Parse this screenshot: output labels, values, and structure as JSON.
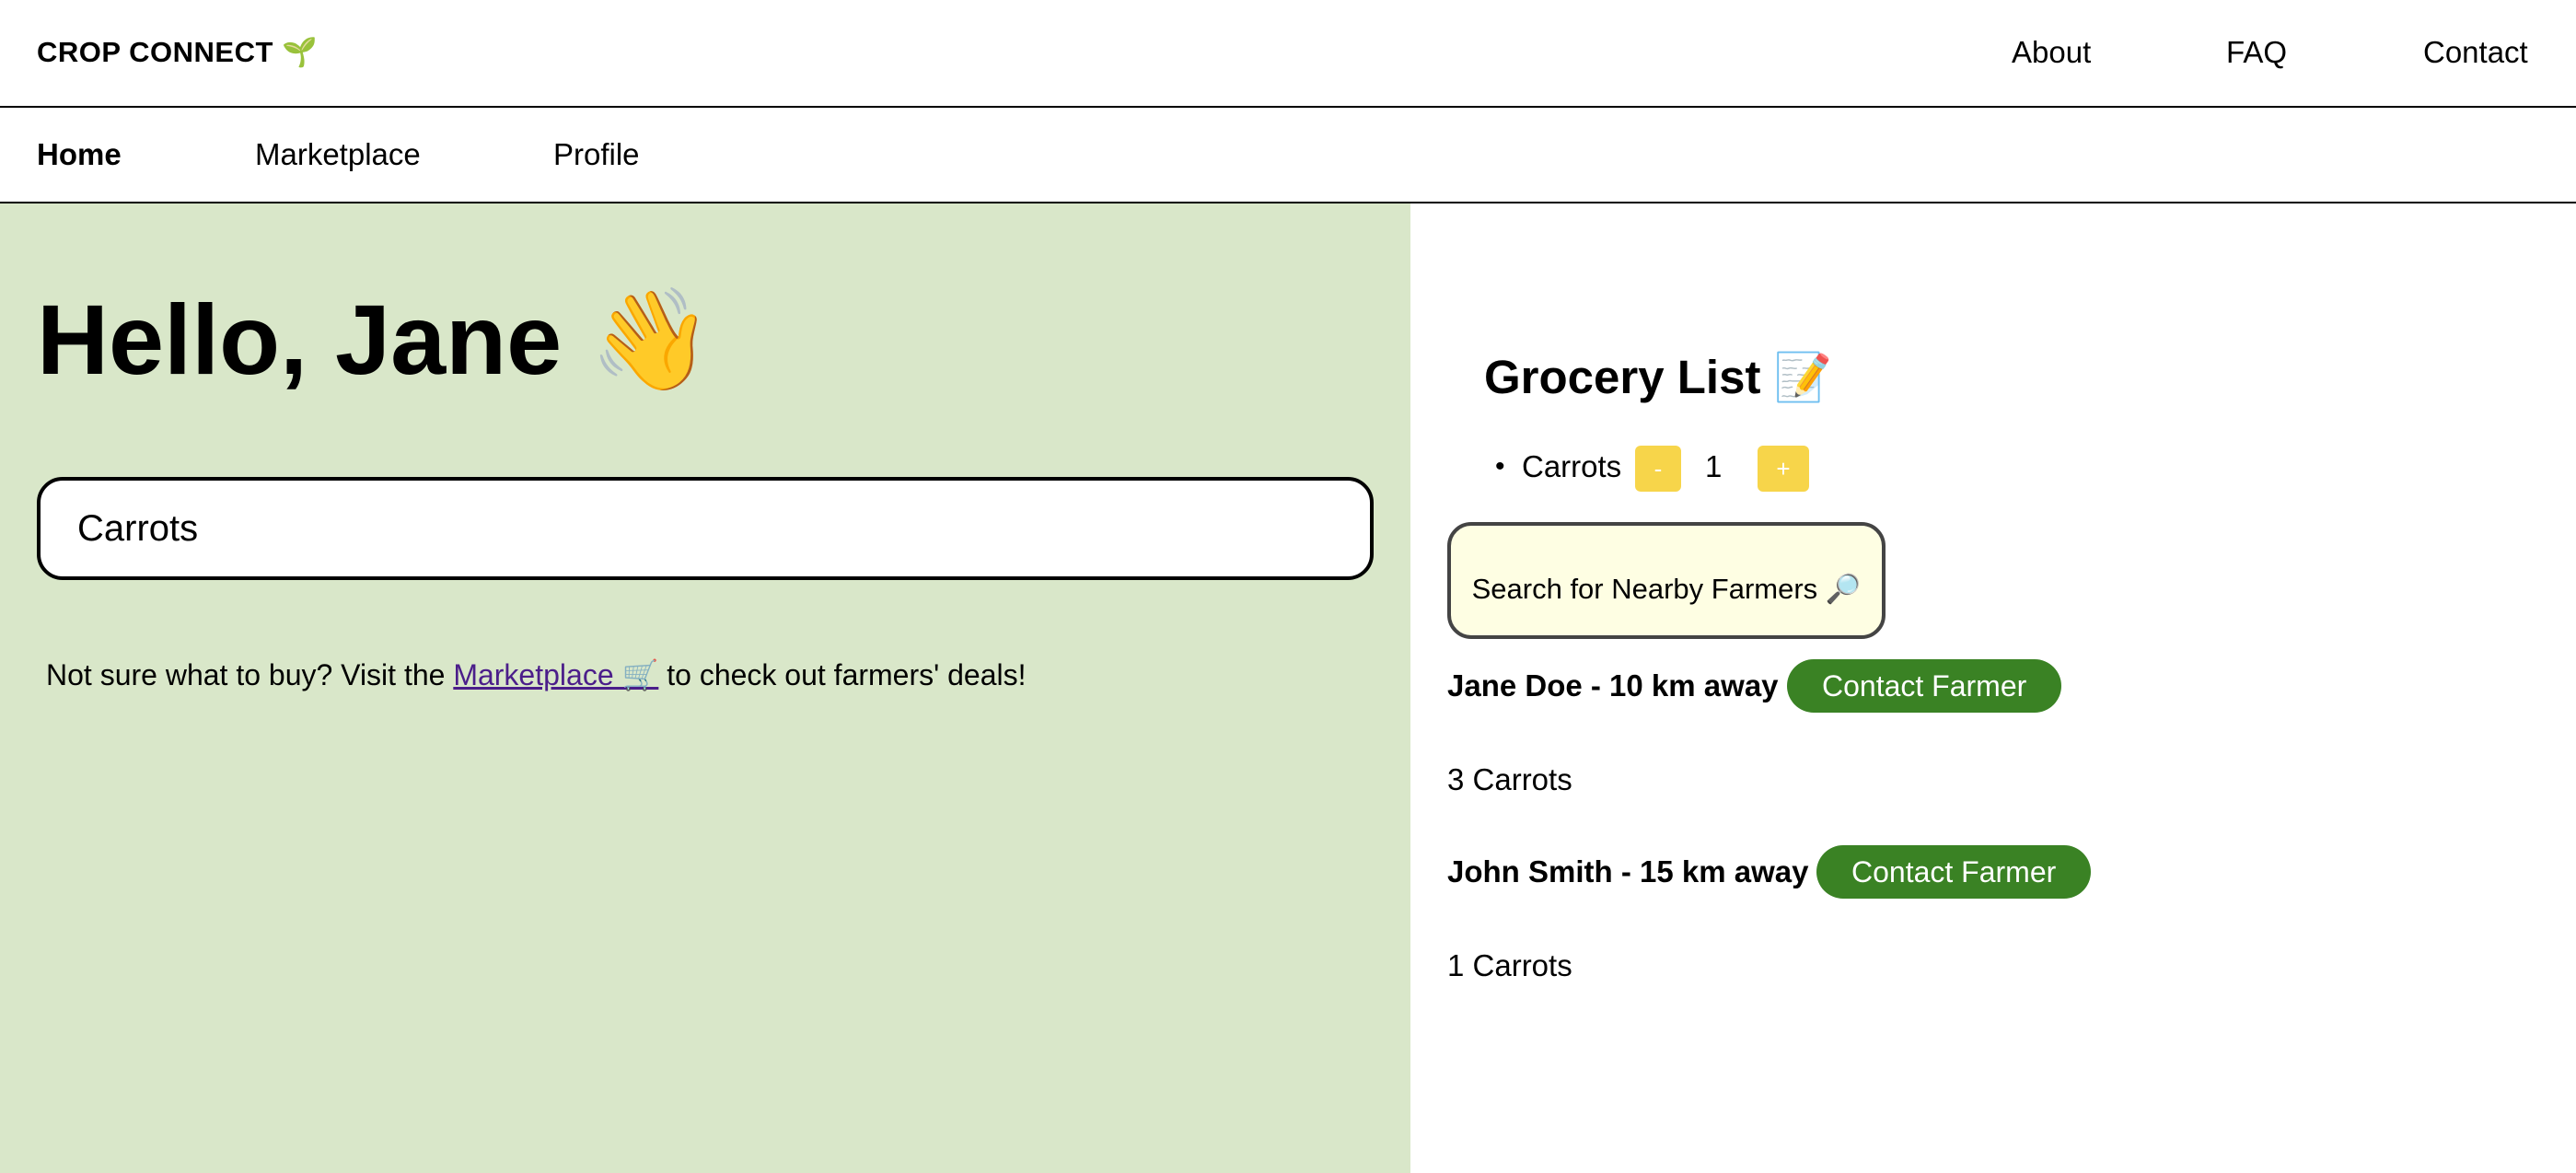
{
  "header": {
    "brand": "CROP CONNECT",
    "brand_icon": "🌱",
    "links": [
      "About",
      "FAQ",
      "Contact"
    ]
  },
  "nav": {
    "items": [
      "Home",
      "Marketplace",
      "Profile"
    ],
    "active": "Home"
  },
  "main": {
    "greeting": "Hello, Jane 👋",
    "search_value": "Carrots",
    "hint_before": "Not sure what to buy? Visit the ",
    "hint_link": "Marketplace 🛒",
    "hint_after": " to check out farmers' deals!"
  },
  "grocery": {
    "title": "Grocery List 📝",
    "items": [
      {
        "name": "Carrots",
        "minus": "-",
        "qty": "1",
        "plus": "+"
      }
    ],
    "search_button": "Search for Nearby Farmers 🔎"
  },
  "farmers": [
    {
      "name": "Jane Doe - 10 km away",
      "contact": "Contact Farmer",
      "offer": "3 Carrots"
    },
    {
      "name": "John Smith - 15 km away",
      "contact": "Contact Farmer",
      "offer": "1 Carrots"
    }
  ],
  "colors": {
    "left_panel": "#d9e7c9",
    "qty_button": "#f7d54a",
    "contact_button": "#3a8224",
    "search_button_bg": "#fefee3",
    "link": "#4b1e8a"
  }
}
